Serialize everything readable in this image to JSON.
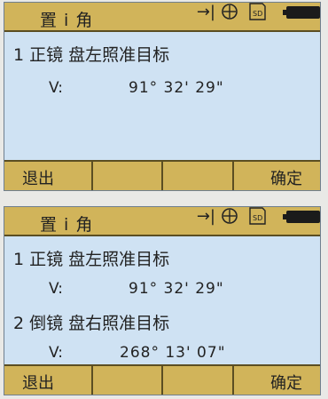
{
  "screens": [
    {
      "title": "置 i 角",
      "status": {
        "arrow": "→|",
        "storage": "SD"
      },
      "items": [
        {
          "label": "1  正镜  盘左照准目标",
          "v_label": "V:",
          "v_value": "91°  32'  29\""
        }
      ],
      "softkeys": {
        "k1": "退出",
        "k2": "",
        "k3": "",
        "k4": "确定"
      }
    },
    {
      "title": "置 i 角",
      "status": {
        "arrow": "→|",
        "storage": "SD"
      },
      "items": [
        {
          "label": "1  正镜  盘左照准目标",
          "v_label": "V:",
          "v_value": "91°  32'  29\""
        },
        {
          "label": "2  倒镜  盘右照准目标",
          "v_label": "V:",
          "v_value": "268°  13'  07\""
        }
      ],
      "softkeys": {
        "k1": "退出",
        "k2": "",
        "k3": "",
        "k4": "确定"
      }
    }
  ],
  "colors": {
    "title_bar": "#d1b45a",
    "screen_bg": "#cfe2f3",
    "text": "#222222"
  }
}
